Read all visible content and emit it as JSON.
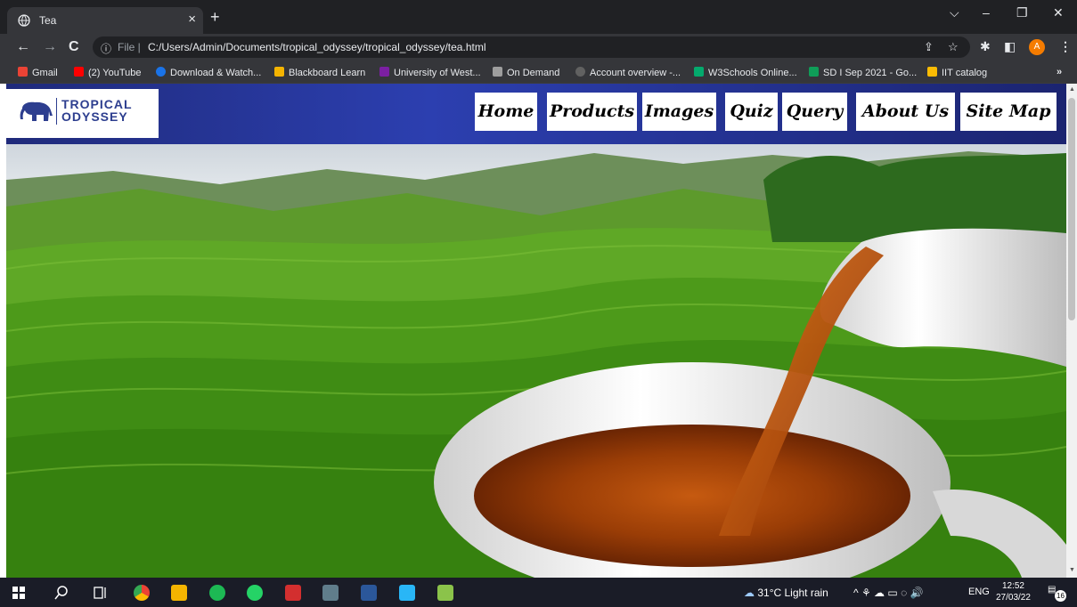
{
  "browser": {
    "tab_title": "Tea",
    "tab_close": "×",
    "new_tab": "+",
    "window_controls": {
      "tabs_menu": "⌵",
      "minimize": "–",
      "restore": "❐",
      "close": "✕"
    },
    "nav": {
      "back": "←",
      "forward": "→",
      "reload": "C"
    },
    "address": {
      "info_icon": "ⓘ",
      "scheme_label": "File |",
      "url": "C:/Users/Admin/Documents/tropical_odyssey/tropical_odyssey/tea.html"
    },
    "toolbar_icons": {
      "share": "⇪",
      "bookmark": "☆",
      "extensions": "✱",
      "sidepanel": "◧",
      "profile": "A",
      "menu": "⋮"
    },
    "bookmarks": [
      {
        "label": "Gmail",
        "color": "#ea4335"
      },
      {
        "label": "(2) YouTube",
        "color": "#ff0000"
      },
      {
        "label": "Download & Watch...",
        "color": "#1a73e8"
      },
      {
        "label": "Blackboard Learn",
        "color": "#f4b400"
      },
      {
        "label": "University of West...",
        "color": "#7b1fa2"
      },
      {
        "label": "On Demand",
        "color": "#9e9e9e"
      },
      {
        "label": "Account overview -...",
        "color": "#616161"
      },
      {
        "label": "W3Schools Online...",
        "color": "#04aa6d"
      },
      {
        "label": "SD I Sep 2021 - Go...",
        "color": "#0f9d58"
      },
      {
        "label": "IIT catalog",
        "color": "#fbbc04"
      }
    ],
    "bookmarks_more": "»"
  },
  "site": {
    "logo_line1": "TROPICAL",
    "logo_line2": "ODYSSEY",
    "nav_items": [
      "Home",
      "Products",
      "Images",
      "Quiz",
      "Query",
      "About Us",
      "Site Map"
    ]
  },
  "taskbar": {
    "weather": "31°C  Light rain",
    "tray_icons": "^ ⚘ ☁ ▭ ◌ 🔊",
    "language": "ENG",
    "time": "12:52",
    "date": "27/03/22",
    "notifications": "16"
  },
  "colors": {
    "header_blue": "#2c3fb0",
    "chrome_dark": "#202124",
    "chrome_mid": "#35363a"
  }
}
